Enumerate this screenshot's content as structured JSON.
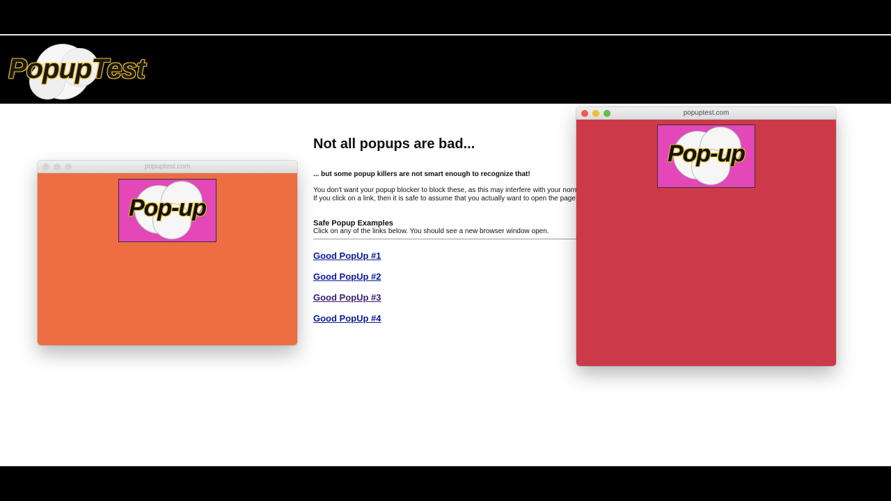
{
  "site": {
    "logo_text": "PopupTest"
  },
  "main": {
    "heading": "Not all popups are bad...",
    "subheading": "... but some popup killers are not smart enough to recognize that!",
    "paragraph_line1": "You don't want your popup blocker to block these, as this may interfere with your norm",
    "paragraph_line2": "If you click on a link, then it is safe to assume that you actually want to open the page,",
    "section_title": "Safe Popup Examples",
    "section_desc": "Click on any of the links below. You should see a new browser window open.",
    "links": [
      {
        "label": "Good PopUp #1",
        "visited": false
      },
      {
        "label": "Good PopUp #2",
        "visited": false
      },
      {
        "label": "Good PopUp #3",
        "visited": true
      },
      {
        "label": "Good PopUp #4",
        "visited": false
      }
    ]
  },
  "popups": [
    {
      "title": "popuptest.com",
      "active": false,
      "image_text": "Pop-up",
      "background": "#ee6e43"
    },
    {
      "title": "popuptest.com",
      "active": true,
      "image_text": "Pop-up",
      "background": "#cc3a4a"
    }
  ],
  "colors": {
    "link": "#0a1a96",
    "link_visited": "#3d1a6e",
    "popup_image_bg": "#e347b8",
    "traffic_close": "#ee5a52",
    "traffic_minimize": "#f5bd2e",
    "traffic_zoom": "#5fc23f",
    "traffic_inactive": "#d4d4d4"
  }
}
